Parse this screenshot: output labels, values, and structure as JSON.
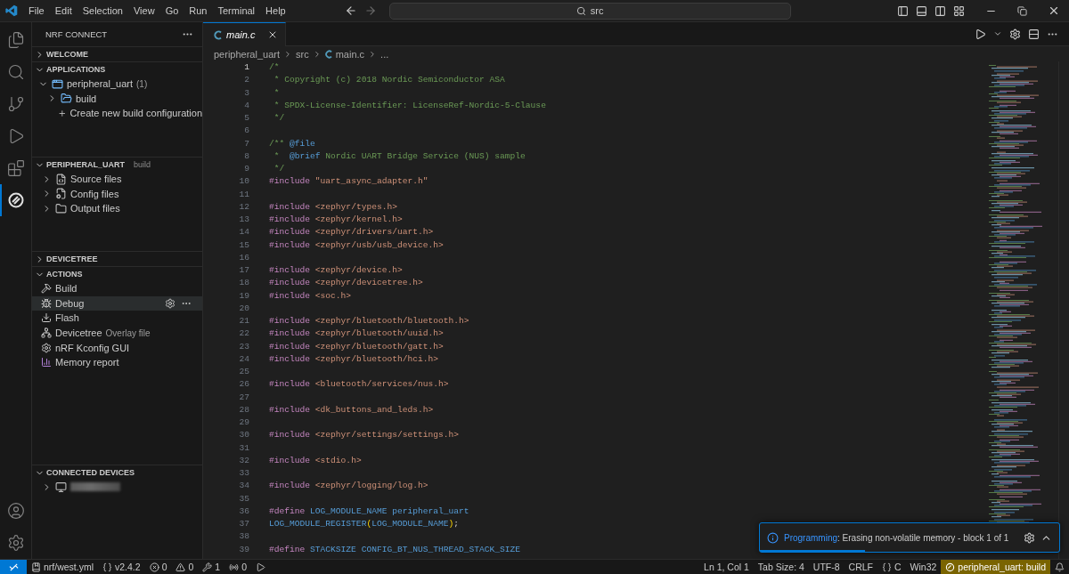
{
  "menu": [
    "File",
    "Edit",
    "Selection",
    "View",
    "Go",
    "Run",
    "Terminal",
    "Help"
  ],
  "command_center": {
    "value": "src"
  },
  "activity_bar": [
    {
      "kind": "explorer",
      "selected": false
    },
    {
      "kind": "search",
      "selected": false
    },
    {
      "kind": "scm",
      "selected": false
    },
    {
      "kind": "run",
      "selected": false
    },
    {
      "kind": "extensions",
      "selected": false
    },
    {
      "kind": "nrf",
      "selected": true
    }
  ],
  "sidebar": {
    "title": "NRF CONNECT",
    "sections": [
      {
        "title": "WELCOME",
        "expanded": false
      },
      {
        "kind": "tree",
        "title": "APPLICATIONS",
        "expanded": true,
        "items": [
          {
            "kind": "app",
            "label": "peripheral_uart",
            "count": "(1)",
            "expanded": true,
            "children": [
              {
                "kind": "build",
                "label": "build",
                "expanded": false
              },
              {
                "kind": "add",
                "label": "Create new build configuration"
              }
            ]
          }
        ]
      },
      {
        "kind": "tree",
        "title": "PERIPHERAL_UART",
        "badge": "build",
        "expanded": true,
        "items": [
          {
            "kind": "source",
            "label": "Source files",
            "expanded": false
          },
          {
            "kind": "config",
            "label": "Config files",
            "expanded": false
          },
          {
            "kind": "output",
            "label": "Output files",
            "expanded": false
          }
        ]
      },
      {
        "title": "DEVICETREE",
        "expanded": false
      },
      {
        "kind": "actions",
        "title": "ACTIONS",
        "expanded": true,
        "items": [
          {
            "kind": "build",
            "label": "Build",
            "selected": false
          },
          {
            "kind": "debug",
            "label": "Debug",
            "selected": true
          },
          {
            "kind": "flash",
            "label": "Flash",
            "selected": false
          },
          {
            "kind": "devicetree",
            "label": "Devicetree",
            "note": "Overlay file",
            "selected": false
          },
          {
            "kind": "kconfig",
            "label": "nRF Kconfig GUI",
            "selected": false
          },
          {
            "kind": "memory",
            "label": "Memory report",
            "selected": false
          }
        ]
      },
      {
        "kind": "devices",
        "title": "CONNECTED DEVICES",
        "expanded": true,
        "items": [
          {
            "kind": "device",
            "expanded": false
          }
        ]
      }
    ]
  },
  "editor": {
    "tab": {
      "label": "main.c",
      "selected": true
    },
    "breadcrumbs": [
      "peripheral_uart",
      "src",
      "main.c",
      "..."
    ],
    "lines": [
      {
        "n": "1",
        "tokens": [
          {
            "kind": "comment",
            "text": "/*"
          }
        ]
      },
      {
        "n": "2",
        "tokens": [
          {
            "kind": "comment",
            "text": " * Copyright (c) 2018 Nordic Semiconductor ASA"
          }
        ]
      },
      {
        "n": "3",
        "tokens": [
          {
            "kind": "comment",
            "text": " *"
          }
        ]
      },
      {
        "n": "4",
        "tokens": [
          {
            "kind": "comment",
            "text": " * SPDX-License-Identifier: LicenseRef-Nordic-5-Clause"
          }
        ]
      },
      {
        "n": "5",
        "tokens": [
          {
            "kind": "comment",
            "text": " */"
          }
        ]
      },
      {
        "n": "6"
      },
      {
        "n": "7",
        "tokens": [
          {
            "kind": "comment",
            "text": "/** "
          },
          {
            "kind": "doc",
            "text": "@file"
          }
        ]
      },
      {
        "n": "8",
        "tokens": [
          {
            "kind": "comment",
            "text": " *  "
          },
          {
            "kind": "doc",
            "text": "@brief"
          },
          {
            "kind": "comment",
            "text": " Nordic UART Bridge Service (NUS) sample"
          }
        ]
      },
      {
        "n": "9",
        "tokens": [
          {
            "kind": "comment",
            "text": " */"
          }
        ]
      },
      {
        "n": "10",
        "tokens": [
          {
            "kind": "directive",
            "text": "#include "
          },
          {
            "kind": "string",
            "text": "\"uart_async_adapter.h\""
          }
        ]
      },
      {
        "n": "11"
      },
      {
        "n": "12",
        "tokens": [
          {
            "kind": "directive",
            "text": "#include "
          },
          {
            "kind": "string",
            "text": "<zephyr/types.h>"
          }
        ]
      },
      {
        "n": "13",
        "tokens": [
          {
            "kind": "directive",
            "text": "#include "
          },
          {
            "kind": "string",
            "text": "<zephyr/kernel.h>"
          }
        ]
      },
      {
        "n": "14",
        "tokens": [
          {
            "kind": "directive",
            "text": "#include "
          },
          {
            "kind": "string",
            "text": "<zephyr/drivers/uart.h>"
          }
        ]
      },
      {
        "n": "15",
        "tokens": [
          {
            "kind": "directive",
            "text": "#include "
          },
          {
            "kind": "string",
            "text": "<zephyr/usb/usb_device.h>"
          }
        ]
      },
      {
        "n": "16"
      },
      {
        "n": "17",
        "tokens": [
          {
            "kind": "directive",
            "text": "#include "
          },
          {
            "kind": "string",
            "text": "<zephyr/device.h>"
          }
        ]
      },
      {
        "n": "18",
        "tokens": [
          {
            "kind": "directive",
            "text": "#include "
          },
          {
            "kind": "string",
            "text": "<zephyr/devicetree.h>"
          }
        ]
      },
      {
        "n": "19",
        "tokens": [
          {
            "kind": "directive",
            "text": "#include "
          },
          {
            "kind": "string",
            "text": "<soc.h>"
          }
        ]
      },
      {
        "n": "20"
      },
      {
        "n": "21",
        "tokens": [
          {
            "kind": "directive",
            "text": "#include "
          },
          {
            "kind": "string",
            "text": "<zephyr/bluetooth/bluetooth.h>"
          }
        ]
      },
      {
        "n": "22",
        "tokens": [
          {
            "kind": "directive",
            "text": "#include "
          },
          {
            "kind": "string",
            "text": "<zephyr/bluetooth/uuid.h>"
          }
        ]
      },
      {
        "n": "23",
        "tokens": [
          {
            "kind": "directive",
            "text": "#include "
          },
          {
            "kind": "string",
            "text": "<zephyr/bluetooth/gatt.h>"
          }
        ]
      },
      {
        "n": "24",
        "tokens": [
          {
            "kind": "directive",
            "text": "#include "
          },
          {
            "kind": "string",
            "text": "<zephyr/bluetooth/hci.h>"
          }
        ]
      },
      {
        "n": "25"
      },
      {
        "n": "26",
        "tokens": [
          {
            "kind": "directive",
            "text": "#include "
          },
          {
            "kind": "string",
            "text": "<bluetooth/services/nus.h>"
          }
        ]
      },
      {
        "n": "27"
      },
      {
        "n": "28",
        "tokens": [
          {
            "kind": "directive",
            "text": "#include "
          },
          {
            "kind": "string",
            "text": "<dk_buttons_and_leds.h>"
          }
        ]
      },
      {
        "n": "29"
      },
      {
        "n": "30",
        "tokens": [
          {
            "kind": "directive",
            "text": "#include "
          },
          {
            "kind": "string",
            "text": "<zephyr/settings/settings.h>"
          }
        ]
      },
      {
        "n": "31"
      },
      {
        "n": "32",
        "tokens": [
          {
            "kind": "directive",
            "text": "#include "
          },
          {
            "kind": "string",
            "text": "<stdio.h>"
          }
        ]
      },
      {
        "n": "33"
      },
      {
        "n": "34",
        "tokens": [
          {
            "kind": "directive",
            "text": "#include "
          },
          {
            "kind": "string",
            "text": "<zephyr/logging/log.h>"
          }
        ]
      },
      {
        "n": "35"
      },
      {
        "n": "36",
        "tokens": [
          {
            "kind": "directive",
            "text": "#define "
          },
          {
            "kind": "macro",
            "text": "LOG_MODULE_NAME peripheral_uart"
          }
        ]
      },
      {
        "n": "37",
        "tokens": [
          {
            "kind": "macro",
            "text": "LOG_MODULE_REGISTER"
          },
          {
            "kind": "paren",
            "text": "("
          },
          {
            "kind": "macro",
            "text": "LOG_MODULE_NAME"
          },
          {
            "kind": "paren",
            "text": ")"
          },
          {
            "kind": "plain",
            "text": ";"
          }
        ]
      },
      {
        "n": "38"
      },
      {
        "n": "39",
        "tokens": [
          {
            "kind": "directive",
            "text": "#define "
          },
          {
            "kind": "macro",
            "text": "STACKSIZE CONFIG_BT_NUS_THREAD_STACK_SIZE"
          }
        ]
      }
    ]
  },
  "notification": {
    "source": "Programming",
    "message": ": Erasing non-volatile memory - block 1 of 1",
    "level": 0.35
  },
  "status_bar": {
    "left": [
      {
        "kind": "manifest",
        "text": "nrf/west.yml"
      },
      {
        "kind": "sdk",
        "text": "v2.4.2"
      },
      {
        "kind": "errors",
        "text": "0"
      },
      {
        "kind": "warnings",
        "text": "0"
      },
      {
        "kind": "tools",
        "text": "1"
      },
      {
        "kind": "ports",
        "text": "0"
      },
      {
        "kind": "debug"
      }
    ],
    "right": [
      {
        "kind": "plain",
        "text": "Ln 1, Col 1"
      },
      {
        "kind": "plain",
        "text": "Tab Size: 4"
      },
      {
        "kind": "plain",
        "text": "UTF-8"
      },
      {
        "kind": "plain",
        "text": "CRLF"
      },
      {
        "kind": "language",
        "text": "C"
      },
      {
        "kind": "plain",
        "text": "Win32"
      },
      {
        "kind": "build",
        "text": "peripheral_uart: build"
      },
      {
        "kind": "bell"
      }
    ]
  }
}
